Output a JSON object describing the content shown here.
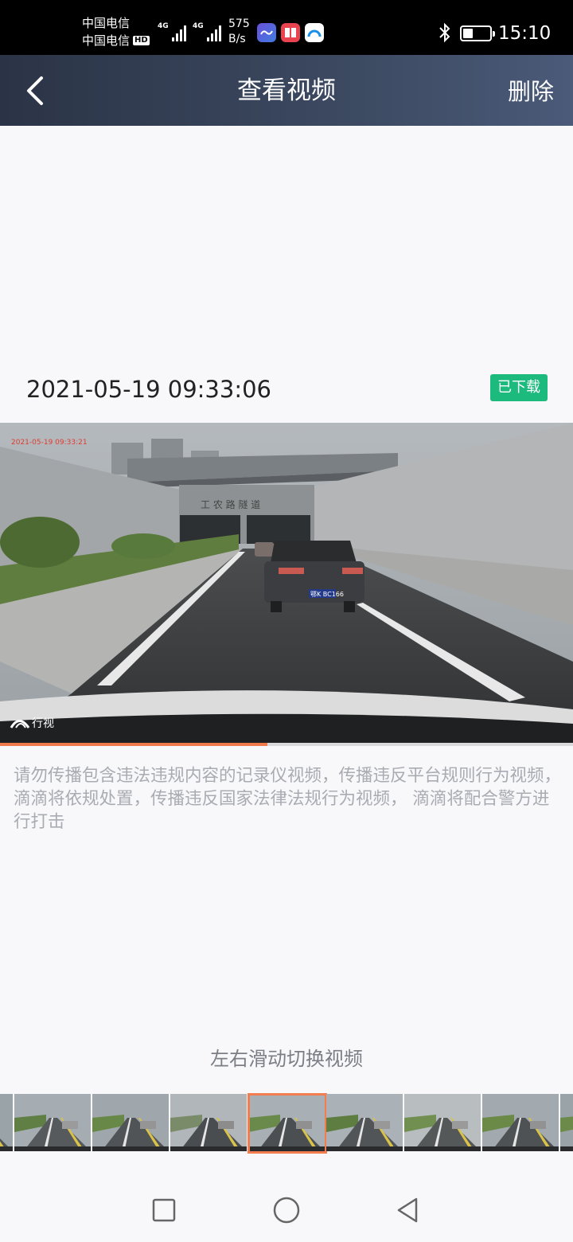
{
  "status_bar": {
    "carrier_1": "中国电信",
    "carrier_2": "中国电信",
    "hd": "HD",
    "net_1": "4G",
    "net_2": "4G",
    "speed_value": "575",
    "speed_unit": "B/s",
    "time": "15:10",
    "battery_level": 0.45
  },
  "title_bar": {
    "back_icon": "chevron-left-icon",
    "title": "查看视频",
    "delete_label": "删除"
  },
  "video": {
    "datetime": "2021-05-19 09:33:06",
    "status_badge": "已下载",
    "badge_color": "#1dba7e",
    "overlay_timestamp": "2021-05-19 09:33:21",
    "watermark": "行视",
    "tunnel_sign": "工 农 路 隧 道",
    "plate": "鄂K BC166",
    "progress": 0.466,
    "progress_color": "#f07a4a"
  },
  "warning": "请勿传播包含违法违规内容的记录仪视频，传播违反平台规则行为视频，滴滴将依规处置，传播违反国家法律法规行为视频， 滴滴将配合警方进行打击",
  "swipe_hint": "左右滑动切换视频",
  "thumbnails": {
    "count": 8,
    "selected_index": 3,
    "selected_color": "#f47d50"
  },
  "nav_bar": {
    "recent_icon": "square-icon",
    "home_icon": "circle-icon",
    "back_icon": "triangle-back-icon"
  }
}
